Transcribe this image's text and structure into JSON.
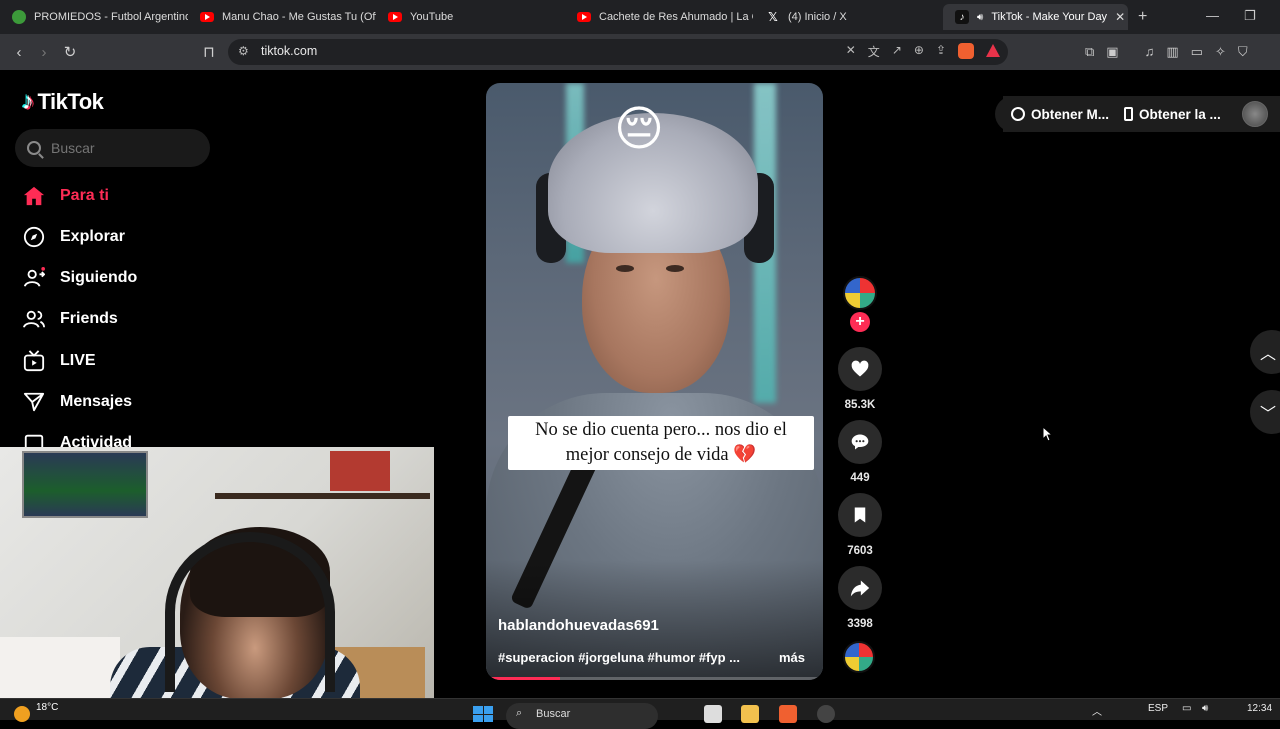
{
  "browser": {
    "tabs": [
      {
        "title": "PROMIEDOS - Futbol Argentino",
        "icon": "promiedos-icon"
      },
      {
        "title": "Manu Chao - Me Gustas Tu (Offi",
        "icon": "youtube-icon"
      },
      {
        "title": "YouTube",
        "icon": "youtube-icon"
      },
      {
        "title": "Cachete de Res Ahumado | La C",
        "icon": "youtube-icon"
      },
      {
        "title": "(4) Inicio / X",
        "icon": "x-icon"
      },
      {
        "title": "TikTok - Make Your Day",
        "icon": "tiktok-icon",
        "active": true
      }
    ],
    "url": "tiktok.com"
  },
  "tiktok": {
    "logo": "TikTok",
    "search_placeholder": "Buscar",
    "nav": [
      {
        "label": "Para ti",
        "icon": "home-icon",
        "active": true
      },
      {
        "label": "Explorar",
        "icon": "compass-icon"
      },
      {
        "label": "Siguiendo",
        "icon": "following-icon"
      },
      {
        "label": "Friends",
        "icon": "friends-icon"
      },
      {
        "label": "LIVE",
        "icon": "live-icon"
      },
      {
        "label": "Mensajes",
        "icon": "messages-icon"
      },
      {
        "label": "Actividad",
        "icon": "activity-icon"
      }
    ],
    "top_buttons": {
      "coins": "Obtener M...",
      "app": "Obtener la ..."
    },
    "video": {
      "caption": "No se dio cuenta pero... nos dio el mejor consejo de vida 💔",
      "author": "hablandohuevadas691",
      "hashtags": "#superacion #jorgeluna #humor #fyp ...",
      "more": "más",
      "progress": 0.22,
      "emoji": "😔"
    },
    "actions": {
      "likes": "85.3K",
      "comments": "449",
      "saves": "7603",
      "shares": "3398"
    }
  },
  "taskbar": {
    "temperature": "18°C",
    "search": "Buscar",
    "language": "ESP",
    "time": "12:34"
  }
}
